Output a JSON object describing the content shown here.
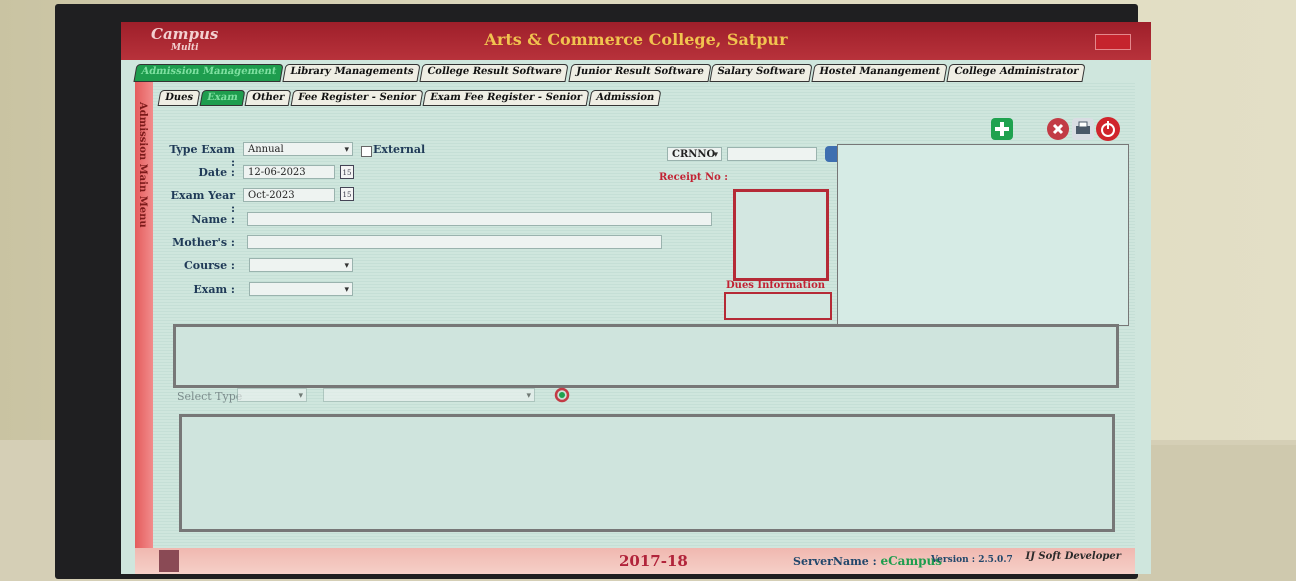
{
  "app": {
    "logo": "Campus",
    "logo_sub": "Multi",
    "title": "Arts & Commerce College, Satpur"
  },
  "main_tabs": [
    {
      "label": "Admission Management",
      "active": true
    },
    {
      "label": "Library Managements",
      "active": false
    },
    {
      "label": "College Result Software",
      "active": false
    },
    {
      "label": "Junior Result Software",
      "active": false
    },
    {
      "label": "Salary Software",
      "active": false
    },
    {
      "label": "Hostel Manangement",
      "active": false
    },
    {
      "label": "College Administrator",
      "active": false
    }
  ],
  "sub_tabs": [
    {
      "label": "Dues",
      "active": false
    },
    {
      "label": "Exam",
      "active": true
    },
    {
      "label": "Other",
      "active": false
    },
    {
      "label": "Fee Register - Senior",
      "active": false
    },
    {
      "label": "Exam Fee Register - Senior",
      "active": false
    },
    {
      "label": "Admission",
      "active": false
    }
  ],
  "side_menu": "Admission Main Menu",
  "form": {
    "type_exam_label": "Type Exam :",
    "type_exam_value": "Annual",
    "external_label": "External",
    "date_label": "Date :",
    "date_value": "12-06-2023",
    "exam_year_label": "Exam Year :",
    "exam_year_value": "Oct-2023",
    "name_label": "Name :",
    "mothers_label": "Mother's :",
    "course_label": "Course :",
    "exam_label": "Exam :",
    "crnno_label": "CRNNO",
    "receipt_label": "Receipt No :",
    "dues_info_label": "Dues Information",
    "select_type_label": "Select Type",
    "calendar_day": "15"
  },
  "status": {
    "year": "2017-18",
    "server_label": "ServerName :",
    "server_name": "eCampus",
    "version_label": "Version :",
    "version": "2.5.0.7",
    "brand": "IJ Soft Developer"
  },
  "colors": {
    "titlebar": "#b8323b",
    "title_text": "#f1c34f",
    "active_tab": "#1e9d4e",
    "accent_red": "#c22233"
  }
}
